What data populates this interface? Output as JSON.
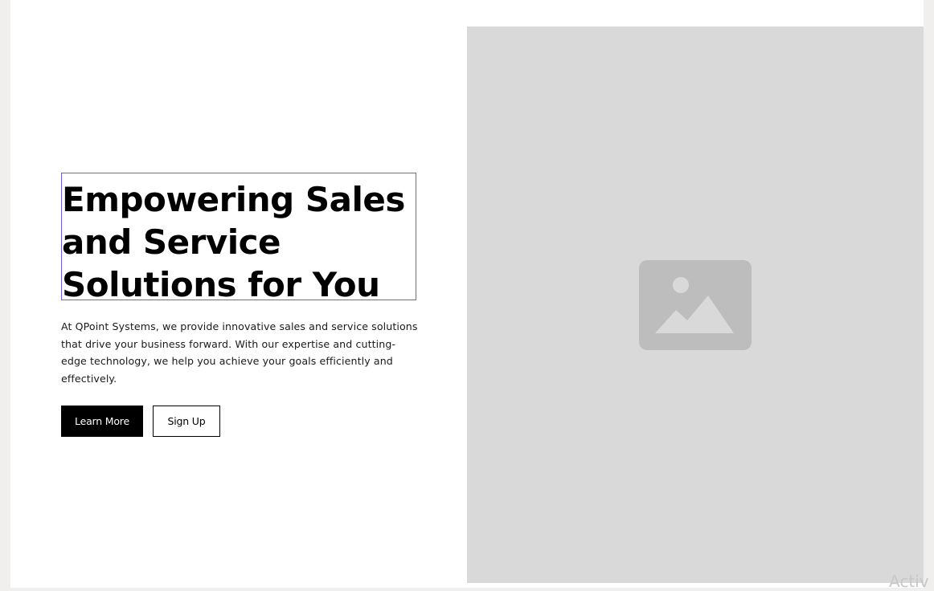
{
  "hero": {
    "title": "Empowering Sales\nand Service\nSolutions for You",
    "description": "At QPoint Systems, we provide innovative sales and service solutions that drive your business forward. With our expertise and cutting-edge technology, we help you achieve your goals efficiently and effectively.",
    "primary_button_label": "Learn More",
    "secondary_button_label": "Sign Up"
  },
  "image_placeholder": {
    "icon": "image-icon"
  },
  "overlay": {
    "watermark_text": "Activ"
  },
  "colors": {
    "page_background": "#f0efed",
    "canvas_background": "#ffffff",
    "selection_outline": "#6a5cf0",
    "image_panel": "#d9d9d9",
    "image_icon": "#bdbdbd",
    "primary_button_bg": "#000000",
    "primary_button_text": "#ffffff"
  }
}
